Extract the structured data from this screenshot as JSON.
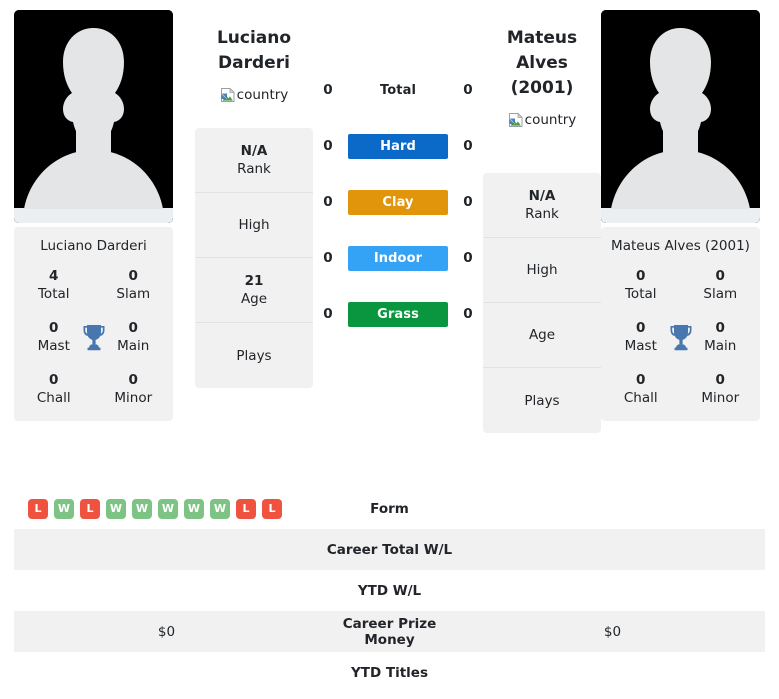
{
  "colors": {
    "hard": "#0b69c7",
    "clay": "#e0950a",
    "indoor": "#34a3f5",
    "grass": "#09963f",
    "win": "#7dc383",
    "loss": "#ef5340",
    "trophy": "#4877b0",
    "panel": "#f1f1f1"
  },
  "players": {
    "left": {
      "full_name_line1": "Luciano",
      "full_name_line2": "Darderi",
      "flag_alt": "country",
      "photo_alt": "player-photo",
      "card_name": "Luciano Darderi",
      "titles": [
        {
          "num": "4",
          "label": "Total"
        },
        {
          "num": "0",
          "label": "Slam"
        },
        {
          "num": "0",
          "label": "Mast"
        },
        {
          "num": "0",
          "label": "Main"
        },
        {
          "num": "0",
          "label": "Chall"
        },
        {
          "num": "0",
          "label": "Minor"
        }
      ],
      "info": [
        {
          "num": "N/A",
          "label": "Rank"
        },
        {
          "num": "",
          "label": "High"
        },
        {
          "num": "21",
          "label": "Age"
        },
        {
          "num": "",
          "label": "Plays"
        }
      ],
      "surface_values": [
        "0",
        "0",
        "0",
        "0",
        "0"
      ],
      "form": [
        "L",
        "W",
        "L",
        "W",
        "W",
        "W",
        "W",
        "W",
        "L",
        "L"
      ],
      "career_total_wl": "",
      "ytd_wl": "",
      "career_prize_money": "$0",
      "ytd_titles": ""
    },
    "right": {
      "full_name_line1": "Mateus Alves",
      "full_name_line2": "(2001)",
      "flag_alt": "country",
      "photo_alt": "player-photo",
      "card_name": "Mateus Alves (2001)",
      "titles": [
        {
          "num": "0",
          "label": "Total"
        },
        {
          "num": "0",
          "label": "Slam"
        },
        {
          "num": "0",
          "label": "Mast"
        },
        {
          "num": "0",
          "label": "Main"
        },
        {
          "num": "0",
          "label": "Chall"
        },
        {
          "num": "0",
          "label": "Minor"
        }
      ],
      "info": [
        {
          "num": "N/A",
          "label": "Rank"
        },
        {
          "num": "",
          "label": "High"
        },
        {
          "num": "",
          "label": "Age"
        },
        {
          "num": "",
          "label": "Plays"
        }
      ],
      "surface_values": [
        "0",
        "0",
        "0",
        "0",
        "0"
      ],
      "form": [],
      "career_total_wl": "",
      "ytd_wl": "",
      "career_prize_money": "$0",
      "ytd_titles": ""
    }
  },
  "surfaces": [
    {
      "label": "Total",
      "style": "plain"
    },
    {
      "label": "Hard",
      "style": "hard"
    },
    {
      "label": "Clay",
      "style": "clay"
    },
    {
      "label": "Indoor",
      "style": "indoor"
    },
    {
      "label": "Grass",
      "style": "grass"
    }
  ],
  "table_rows": [
    {
      "label": "Form"
    },
    {
      "label": "Career Total W/L"
    },
    {
      "label": "YTD W/L"
    },
    {
      "label": "Career Prize Money"
    },
    {
      "label": "YTD Titles"
    }
  ]
}
